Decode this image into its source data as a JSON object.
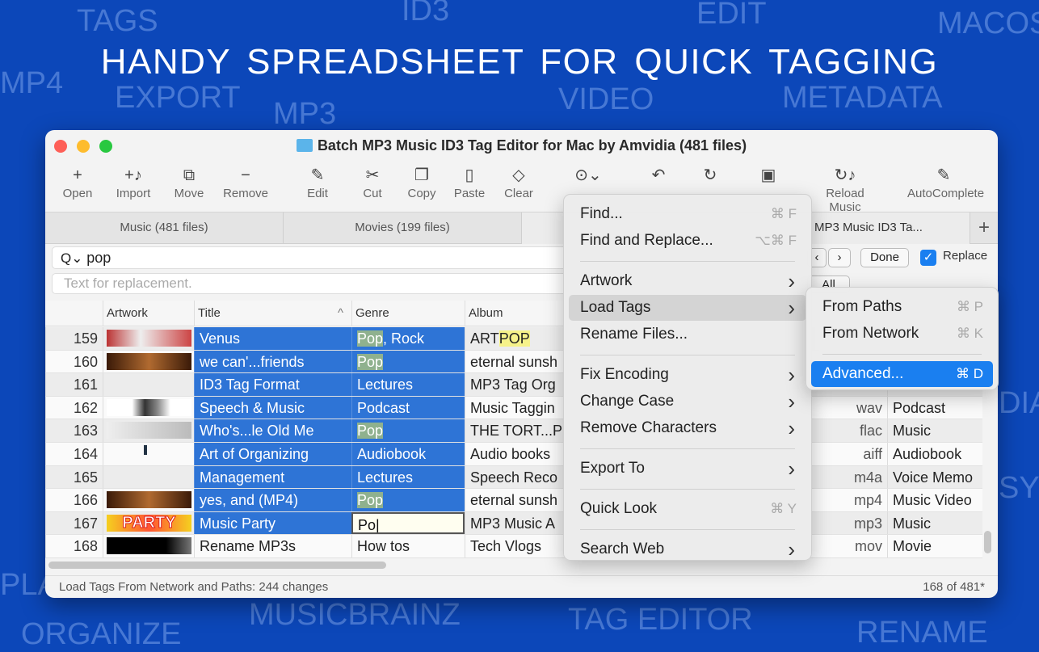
{
  "background": {
    "headline": "HANDY SPREADSHEET FOR QUICK TAGGING",
    "words": [
      "TAGS",
      "ID3",
      "EDIT",
      "MACOS",
      "MP4",
      "EXPORT",
      "MP3",
      "VIDEO",
      "METADATA",
      "DIA",
      "SY",
      "PLAY",
      "ORGANIZE",
      "MUSICBRAINZ",
      "TAG EDITOR",
      "RENAME"
    ]
  },
  "window": {
    "title": "Batch MP3 Music ID3 Tag Editor for Mac by Amvidia (481 files)"
  },
  "toolbar": [
    {
      "icon": "plus",
      "label": "Open"
    },
    {
      "icon": "import-music",
      "label": "Import"
    },
    {
      "icon": "move",
      "label": "Move"
    },
    {
      "icon": "minus",
      "label": "Remove"
    },
    {
      "icon": "pencil",
      "label": "Edit"
    },
    {
      "icon": "scissors",
      "label": "Cut"
    },
    {
      "icon": "copy",
      "label": "Copy"
    },
    {
      "icon": "paste",
      "label": "Paste"
    },
    {
      "icon": "eraser",
      "label": "Clear"
    },
    {
      "icon": "more",
      "label": ""
    },
    {
      "icon": "undo",
      "label": ""
    },
    {
      "icon": "redo",
      "label": ""
    },
    {
      "icon": "save",
      "label": ""
    },
    {
      "icon": "reload-music",
      "label": "Reload Music"
    },
    {
      "icon": "autocomplete",
      "label": "AutoComplete"
    }
  ],
  "tabs": [
    "Music (481 files)",
    "Movies (199 files)",
    "MP3 Music ID3 Ta..."
  ],
  "search": {
    "value": "pop",
    "replace_placeholder": "Text for replacement.",
    "done": "Done",
    "replace_label": "Replace",
    "replace_checked": true,
    "all": "All"
  },
  "columns": [
    "Artwork",
    "Title",
    "Genre",
    "Album"
  ],
  "rows": [
    {
      "n": "159",
      "title": "Venus",
      "genre": "Pop, Rock",
      "album": "ARTPOP",
      "ext": "",
      "kind": ""
    },
    {
      "n": "160",
      "title": "we can'...friends",
      "genre": "Pop",
      "album": "eternal sunsh",
      "ext": "",
      "kind": ""
    },
    {
      "n": "161",
      "title": "ID3 Tag Format",
      "genre": "Lectures",
      "album": "MP3 Tag Org",
      "ext": "",
      "kind": ""
    },
    {
      "n": "162",
      "title": "Speech & Music",
      "genre": "Podcast",
      "album": "Music Taggin",
      "ext": "wav",
      "kind": "Podcast"
    },
    {
      "n": "163",
      "title": "Who's...le Old Me",
      "genre": "Pop",
      "album": "THE TORT...P",
      "ext": "flac",
      "kind": "Music"
    },
    {
      "n": "164",
      "title": "Art of Organizing",
      "genre": "Audiobook",
      "album": "Audio books",
      "ext": "aiff",
      "kind": "Audiobook"
    },
    {
      "n": "165",
      "title": "Management",
      "genre": "Lectures",
      "album": "Speech Reco",
      "ext": "m4a",
      "kind": "Voice Memo"
    },
    {
      "n": "166",
      "title": "yes, and (MP4)",
      "genre": "Pop",
      "album": "eternal sunsh",
      "ext": "mp4",
      "kind": "Music Video"
    },
    {
      "n": "167",
      "title": "Music Party",
      "genre": "Po",
      "album": "MP3 Music A",
      "ext": "mp3",
      "kind": "Music"
    },
    {
      "n": "168",
      "title": "Rename MP3s",
      "genre": "How tos",
      "album": "Tech Vlogs",
      "ext": "mov",
      "kind": "Movie"
    }
  ],
  "menu": [
    {
      "label": "Find...",
      "sc": "⌘ F"
    },
    {
      "label": "Find and Replace...",
      "sc": "⌥⌘ F"
    },
    {
      "sep": true
    },
    {
      "label": "Artwork",
      "sub": true
    },
    {
      "label": "Load Tags",
      "sub": true,
      "hover": true
    },
    {
      "label": "Rename Files..."
    },
    {
      "sep": true
    },
    {
      "label": "Fix Encoding",
      "sub": true
    },
    {
      "label": "Change Case",
      "sub": true
    },
    {
      "label": "Remove Characters",
      "sub": true
    },
    {
      "sep": true
    },
    {
      "label": "Export To",
      "sub": true
    },
    {
      "sep": true
    },
    {
      "label": "Quick Look",
      "sc": "⌘ Y"
    },
    {
      "sep": true
    },
    {
      "label": "Search Web",
      "sub": true
    }
  ],
  "submenu": [
    {
      "label": "From Paths",
      "sc": "⌘ P"
    },
    {
      "label": "From Network",
      "sc": "⌘ K"
    },
    {
      "sep": true
    },
    {
      "label": "Advanced...",
      "sc": "⌘ D",
      "active": true
    }
  ],
  "status": {
    "left": "Load Tags From Network and Paths: 244 changes",
    "right": "168 of 481*"
  },
  "colors": {
    "background": "#0c47b9",
    "selection": "#2e74d6",
    "menu_active": "#1a7ff0"
  }
}
